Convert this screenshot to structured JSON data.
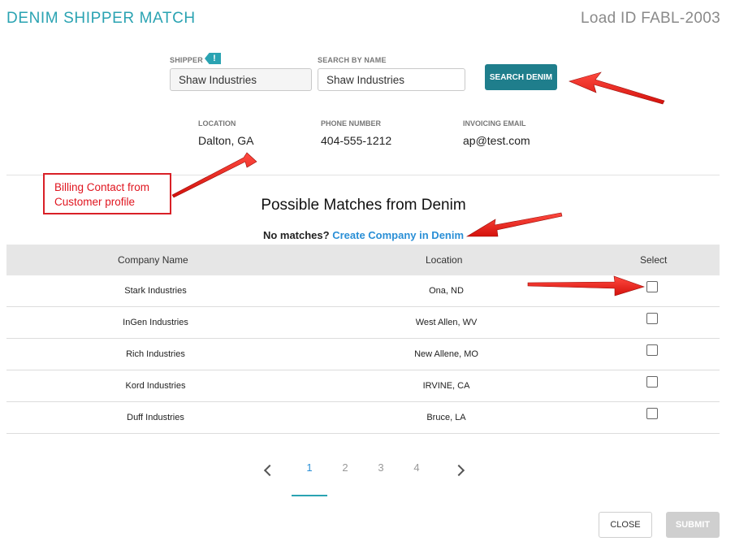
{
  "header": {
    "title": "DENIM SHIPPER MATCH",
    "load_id": "Load ID FABL-2003"
  },
  "form": {
    "shipper_label": "SHIPPER",
    "shipper_flag": "!",
    "shipper_value": "Shaw Industries",
    "search_label": "SEARCH BY NAME",
    "search_value": "Shaw Industries",
    "search_button": "SEARCH DENIM"
  },
  "info": {
    "location_label": "LOCATION",
    "location_value": "Dalton, GA",
    "phone_label": "PHONE NUMBER",
    "phone_value": "404-555-1212",
    "email_label": "INVOICING EMAIL",
    "email_value": "ap@test.com"
  },
  "annotation": {
    "line1": "Billing Contact from",
    "line2": "Customer profile"
  },
  "matches": {
    "heading": "Possible Matches from Denim",
    "no_match_text": "No matches?",
    "create_link": "Create Company in Denim",
    "columns": [
      "Company Name",
      "Location",
      "Select"
    ],
    "rows": [
      {
        "company": "Stark Industries",
        "location": "Ona, ND",
        "selected": false
      },
      {
        "company": "InGen Industries",
        "location": "West Allen, WV",
        "selected": false
      },
      {
        "company": "Rich Industries",
        "location": "New Allene, MO",
        "selected": false
      },
      {
        "company": "Kord Industries",
        "location": "IRVINE, CA",
        "selected": false
      },
      {
        "company": "Duff Industries",
        "location": "Bruce, LA",
        "selected": false
      }
    ]
  },
  "pagination": {
    "pages": [
      "1",
      "2",
      "3",
      "4"
    ],
    "current": "1"
  },
  "footer": {
    "close_label": "CLOSE",
    "submit_label": "SUBMIT"
  },
  "colors": {
    "accent": "#2aa3b2",
    "button": "#1f7e8c",
    "link": "#2a8fd6",
    "annotation": "#e0151f"
  }
}
